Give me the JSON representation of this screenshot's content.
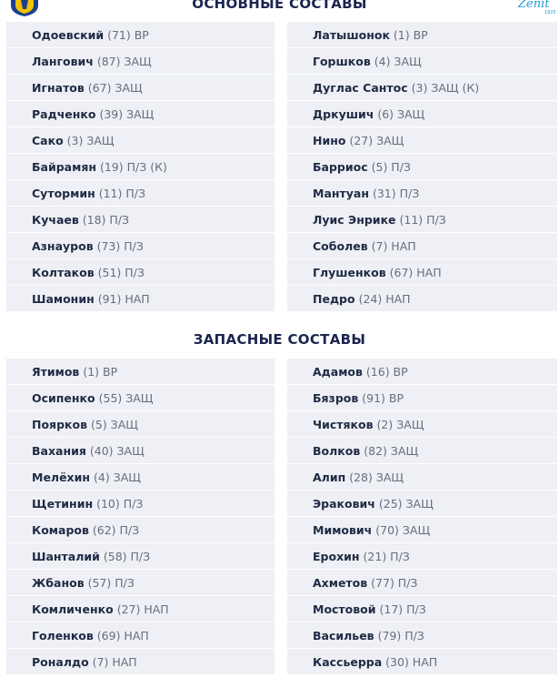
{
  "sections": {
    "main_title": "ОСНОВНЫЕ СОСТАВЫ",
    "subs_title": "ЗАПАСНЫЕ СОСТАВЫ"
  },
  "logos": {
    "left": "rostov-logo-icon",
    "right_text": "Zenit",
    "right_year": "1925",
    "colors": {
      "left_blue": "#1f3e8c",
      "left_yellow": "#f2c200",
      "right_blue": "#1d9ad6"
    }
  },
  "main": {
    "left": [
      {
        "name": "Одоевский",
        "info": "(71) ВР"
      },
      {
        "name": "Лангович",
        "info": "(87) ЗАЩ"
      },
      {
        "name": "Игнатов",
        "info": "(67) ЗАЩ"
      },
      {
        "name": "Радченко",
        "info": "(39) ЗАЩ"
      },
      {
        "name": "Сако",
        "info": "(3) ЗАЩ"
      },
      {
        "name": "Байрамян",
        "info": "(19) П/З (К)"
      },
      {
        "name": "Сутормин",
        "info": "(11) П/З"
      },
      {
        "name": "Кучаев",
        "info": "(18) П/З"
      },
      {
        "name": "Азнауров",
        "info": "(73) П/З"
      },
      {
        "name": "Колтаков",
        "info": "(51) П/З"
      },
      {
        "name": "Шамонин",
        "info": "(91) НАП"
      }
    ],
    "right": [
      {
        "name": "Латышонок",
        "info": "(1) ВР"
      },
      {
        "name": "Горшков",
        "info": "(4) ЗАЩ"
      },
      {
        "name": "Дуглас Сантос",
        "info": "(3) ЗАЩ (К)"
      },
      {
        "name": "Дркушич",
        "info": "(6) ЗАЩ"
      },
      {
        "name": "Нино",
        "info": "(27) ЗАЩ"
      },
      {
        "name": "Барриос",
        "info": "(5) П/З"
      },
      {
        "name": "Мантуан",
        "info": "(31) П/З"
      },
      {
        "name": "Луис Энрике",
        "info": "(11) П/З"
      },
      {
        "name": "Соболев",
        "info": "(7) НАП"
      },
      {
        "name": "Глушенков",
        "info": "(67) НАП"
      },
      {
        "name": "Педро",
        "info": "(24) НАП"
      }
    ]
  },
  "subs": {
    "left": [
      {
        "name": "Ятимов",
        "info": "(1) ВР"
      },
      {
        "name": "Осипенко",
        "info": "(55) ЗАЩ"
      },
      {
        "name": "Поярков",
        "info": "(5) ЗАЩ"
      },
      {
        "name": "Вахания",
        "info": "(40) ЗАЩ"
      },
      {
        "name": "Мелёхин",
        "info": "(4) ЗАЩ"
      },
      {
        "name": "Щетинин",
        "info": "(10) П/З"
      },
      {
        "name": "Комаров",
        "info": "(62) П/З"
      },
      {
        "name": "Шанталий",
        "info": "(58) П/З"
      },
      {
        "name": "Жбанов",
        "info": "(57) П/З"
      },
      {
        "name": "Комличенко",
        "info": "(27) НАП"
      },
      {
        "name": "Голенков",
        "info": "(69) НАП"
      },
      {
        "name": "Роналдо",
        "info": "(7) НАП"
      }
    ],
    "right": [
      {
        "name": "Адамов",
        "info": "(16) ВР"
      },
      {
        "name": "Бязров",
        "info": "(91) ВР"
      },
      {
        "name": "Чистяков",
        "info": "(2) ЗАЩ"
      },
      {
        "name": "Волков",
        "info": "(82) ЗАЩ"
      },
      {
        "name": "Алип",
        "info": "(28) ЗАЩ"
      },
      {
        "name": "Эракович",
        "info": "(25) ЗАЩ"
      },
      {
        "name": "Мимович",
        "info": "(70) ЗАЩ"
      },
      {
        "name": "Ерохин",
        "info": "(21) П/З"
      },
      {
        "name": "Ахметов",
        "info": "(77) П/З"
      },
      {
        "name": "Мостовой",
        "info": "(17) П/З"
      },
      {
        "name": "Васильев",
        "info": "(79) П/З"
      },
      {
        "name": "Кассьерра",
        "info": "(30) НАП"
      }
    ]
  }
}
